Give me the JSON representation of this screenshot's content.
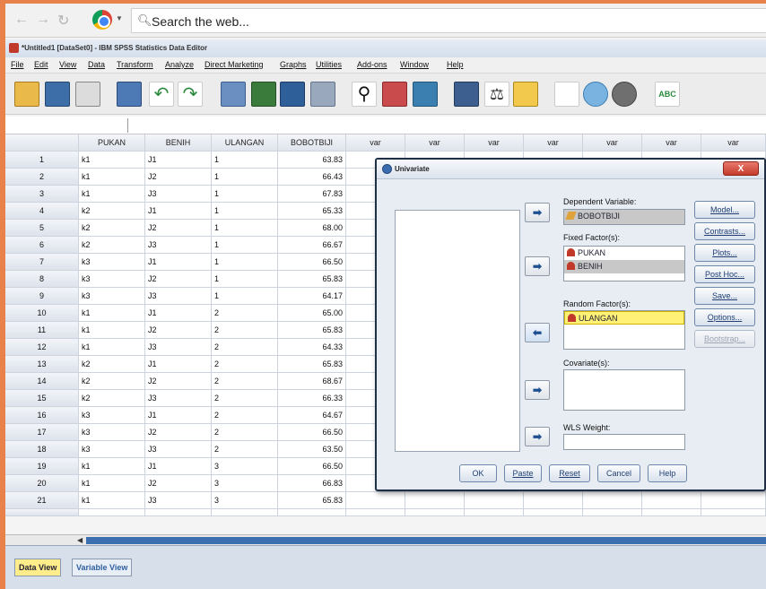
{
  "browser": {
    "search_placeholder": "Search the web..."
  },
  "window": {
    "title": "*Untitled1 [DataSet0] - IBM SPSS Statistics Data Editor"
  },
  "menu": [
    "File",
    "Edit",
    "View",
    "Data",
    "Transform",
    "Analyze",
    "Direct Marketing",
    "Graphs",
    "Utilities",
    "Add-ons",
    "Window",
    "Help"
  ],
  "grid": {
    "headers": [
      "PUKAN",
      "BENIH",
      "ULANGAN",
      "BOBOTBIJI",
      "var",
      "var",
      "var",
      "var",
      "var",
      "var",
      "var"
    ],
    "rows": [
      [
        "1",
        "k1",
        "J1",
        "1",
        "63.83"
      ],
      [
        "2",
        "k1",
        "J2",
        "1",
        "66.43"
      ],
      [
        "3",
        "k1",
        "J3",
        "1",
        "67.83"
      ],
      [
        "4",
        "k2",
        "J1",
        "1",
        "65.33"
      ],
      [
        "5",
        "k2",
        "J2",
        "1",
        "68.00"
      ],
      [
        "6",
        "k2",
        "J3",
        "1",
        "66.67"
      ],
      [
        "7",
        "k3",
        "J1",
        "1",
        "66.50"
      ],
      [
        "8",
        "k3",
        "J2",
        "1",
        "65.83"
      ],
      [
        "9",
        "k3",
        "J3",
        "1",
        "64.17"
      ],
      [
        "10",
        "k1",
        "J1",
        "2",
        "65.00"
      ],
      [
        "11",
        "k1",
        "J2",
        "2",
        "65.83"
      ],
      [
        "12",
        "k1",
        "J3",
        "2",
        "64.33"
      ],
      [
        "13",
        "k2",
        "J1",
        "2",
        "65.83"
      ],
      [
        "14",
        "k2",
        "J2",
        "2",
        "68.67"
      ],
      [
        "15",
        "k2",
        "J3",
        "2",
        "66.33"
      ],
      [
        "16",
        "k3",
        "J1",
        "2",
        "64.67"
      ],
      [
        "17",
        "k3",
        "J2",
        "2",
        "66.50"
      ],
      [
        "18",
        "k3",
        "J3",
        "2",
        "63.50"
      ],
      [
        "19",
        "k1",
        "J1",
        "3",
        "66.50"
      ],
      [
        "20",
        "k1",
        "J2",
        "3",
        "66.83"
      ],
      [
        "21",
        "k1",
        "J3",
        "3",
        "65.83"
      ]
    ]
  },
  "tabs": {
    "data_view": "Data View",
    "variable_view": "Variable View"
  },
  "dialog": {
    "title": "Univariate",
    "close_label": "X",
    "dependent_label": "Dependent Variable:",
    "dependent_value": "BOBOTBIJI",
    "fixed_label": "Fixed Factor(s):",
    "fixed_items": [
      "PUKAN",
      "BENIH"
    ],
    "random_label": "Random Factor(s):",
    "random_items": [
      "ULANGAN"
    ],
    "covariate_label": "Covariate(s):",
    "wls_label": "WLS Weight:",
    "side_buttons": [
      "Model...",
      "Contrasts...",
      "Plots...",
      "Post Hoc...",
      "Save...",
      "Options...",
      "Bootstrap..."
    ],
    "bottom_buttons": [
      "OK",
      "Paste",
      "Reset",
      "Cancel",
      "Help"
    ]
  },
  "colors": {
    "accent_orange": "#e8824a",
    "selection_yellow": "#fff176",
    "header_blue": "#3b6fb0"
  }
}
